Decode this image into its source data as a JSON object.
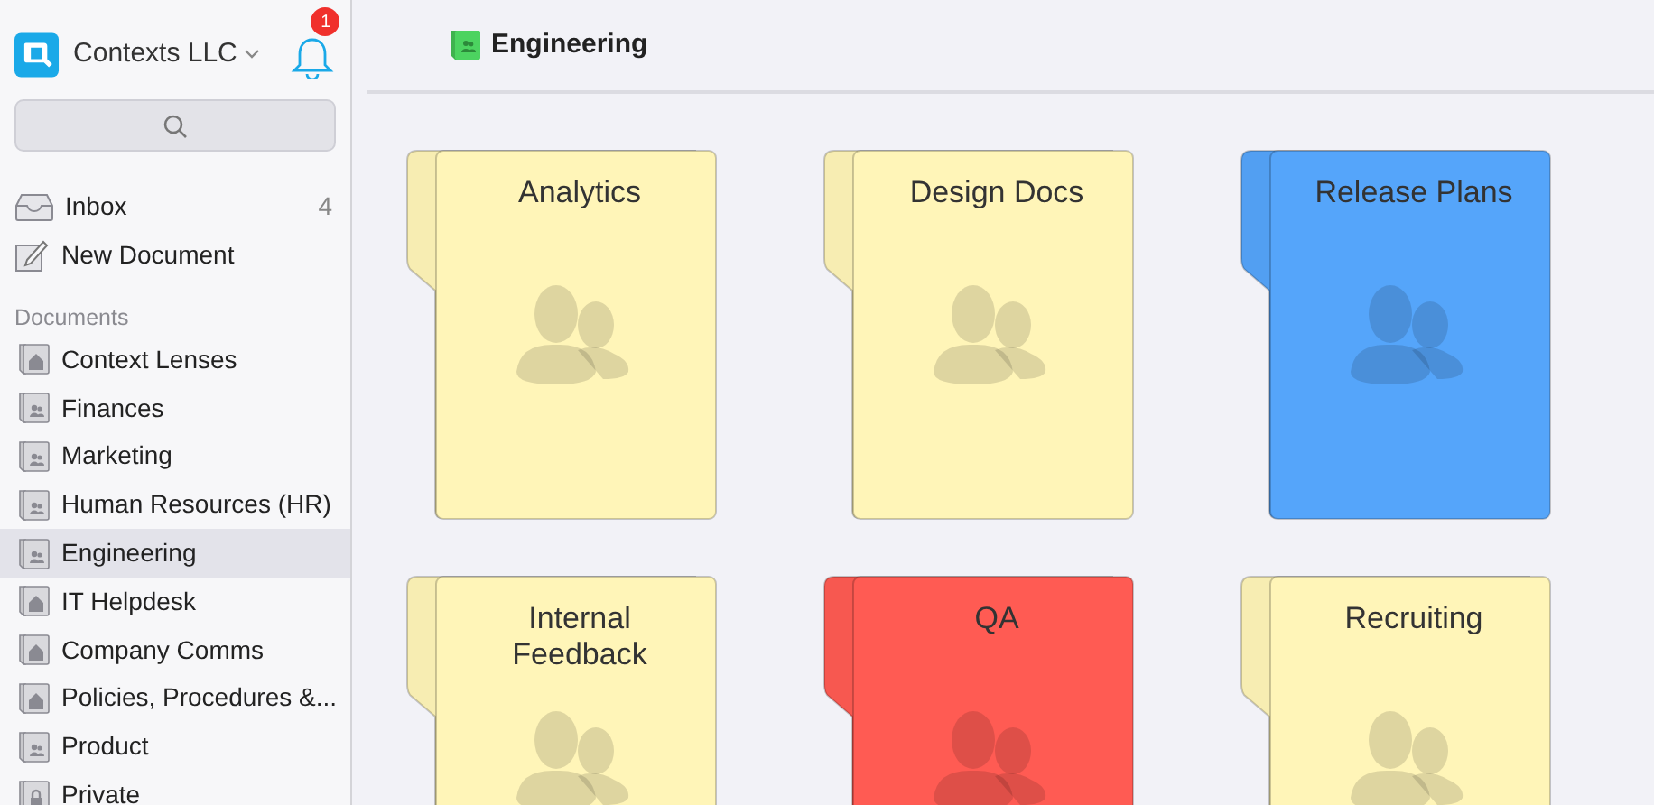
{
  "sidebar": {
    "workspace": "Contexts LLC",
    "notifications_badge": "1",
    "items": [
      {
        "label": "Inbox",
        "kind": "inbox",
        "count": "4"
      },
      {
        "label": "New Document",
        "kind": "compose"
      }
    ],
    "section_label": "Documents",
    "documents": [
      {
        "label": "Context Lenses",
        "kind": "home",
        "selected": false
      },
      {
        "label": "Finances",
        "kind": "people",
        "selected": false
      },
      {
        "label": "Marketing",
        "kind": "people",
        "selected": false
      },
      {
        "label": "Human Resources (HR)",
        "kind": "people",
        "selected": false
      },
      {
        "label": "Engineering",
        "kind": "people",
        "selected": true
      },
      {
        "label": "IT Helpdesk",
        "kind": "home",
        "selected": false
      },
      {
        "label": "Company Comms",
        "kind": "home",
        "selected": false
      },
      {
        "label": "Policies, Procedures &...",
        "kind": "home",
        "selected": false
      },
      {
        "label": "Product",
        "kind": "people",
        "selected": false
      },
      {
        "label": "Private",
        "kind": "lock",
        "selected": false
      }
    ]
  },
  "header": {
    "title": "Engineering"
  },
  "folders": [
    {
      "title": "Analytics",
      "color": "#fff5b8"
    },
    {
      "title": "Design Docs",
      "color": "#fff5b8"
    },
    {
      "title": "Release Plans",
      "color": "#55a5fa"
    },
    {
      "title": "Internal Feedback",
      "color": "#fff5b8"
    },
    {
      "title": "QA",
      "color": "#ff5b53"
    },
    {
      "title": "Recruiting",
      "color": "#fff5b8"
    }
  ]
}
